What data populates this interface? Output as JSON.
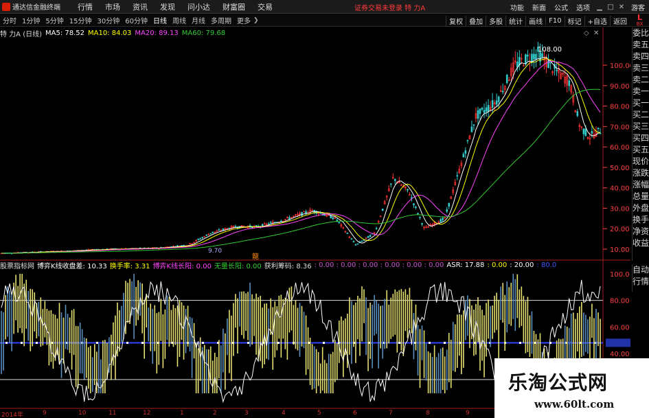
{
  "app": {
    "title": "通达信金融终端",
    "menu": [
      "行情",
      "市场",
      "资讯",
      "发现",
      "问小达",
      "财富圈",
      "交易"
    ],
    "notice": "证券交易未登录  特 力A",
    "right_menu": [
      "功能",
      "新面",
      "公式",
      "选项"
    ],
    "user": "游客"
  },
  "periods": {
    "items": [
      "分时",
      "1分钟",
      "5分钟",
      "15分钟",
      "30分钟",
      "60分钟",
      "日线",
      "周线",
      "月线",
      "多周期",
      "更多"
    ],
    "active": "日线",
    "tools": [
      "复权",
      "叠加",
      "多股",
      "统计",
      "画线",
      "F10",
      "标记",
      "+自选",
      "返回"
    ],
    "badge_top": "L",
    "badge_bottom": "BX"
  },
  "main_header": {
    "stock": "特 力A (日线)",
    "ma5": "MA5: 78.52",
    "ma10": "MA10: 84.03",
    "ma20": "MA20: 89.13",
    "ma60": "MA60: 79.68"
  },
  "sidebar": [
    "委比",
    "卖五",
    "卖四",
    "卖三",
    "卖二",
    "卖一",
    "买一",
    "买二",
    "买三",
    "买四",
    "买五",
    "现价",
    "涨跌",
    "涨幅",
    "总量",
    "外盘",
    "换手",
    "净资",
    "收益"
  ],
  "sidebar2": [
    "自动",
    "行情"
  ],
  "sub_header": {
    "name": "股票指标网",
    "i1": "博弈K线收盘差: 10.33",
    "i2": "换手率: 3.31",
    "i3": "博弈K线长阳: 0.00",
    "i4": "无量长阳: 0.00",
    "i5": "获利筹码: 8.36",
    "zeros": ": 0.00 : 0.00 : 0.00 : 0.00 : 0.00 : 0.00",
    "asr": "ASR: 17.88",
    "v1": ": 0.00",
    "v2": ": 20.00",
    "v3": ": 80.0"
  },
  "price_axis": [
    "100.00",
    "90.00",
    "80.00",
    "70.00",
    "60.00",
    "50.00",
    "40.00",
    "30.00",
    "20.00",
    "10.00"
  ],
  "sub_axis": [
    "100.0",
    "80.00",
    "60.00",
    "48.06",
    "40.00"
  ],
  "annotations": {
    "high": "108.00",
    "low": "9.70",
    "marker": "龍"
  },
  "xaxis": {
    "year": "2014年",
    "months": [
      "9",
      "10",
      "11",
      "12",
      "1",
      "2",
      "3",
      "4",
      "5",
      "6",
      "7",
      "8",
      "9"
    ]
  },
  "watermark": {
    "line1": "乐淘公式网",
    "line2": "www.60lt.com"
  },
  "colors": {
    "up": "#ff3333",
    "ma5": "#ffffff",
    "ma10": "#ffff00",
    "ma20": "#ff44ff",
    "ma60": "#33cc33",
    "axis_text": "#ff4040",
    "sub_bar": "#e6e070",
    "sub_line": "#ffffff",
    "level_line": "#3344ff"
  }
}
